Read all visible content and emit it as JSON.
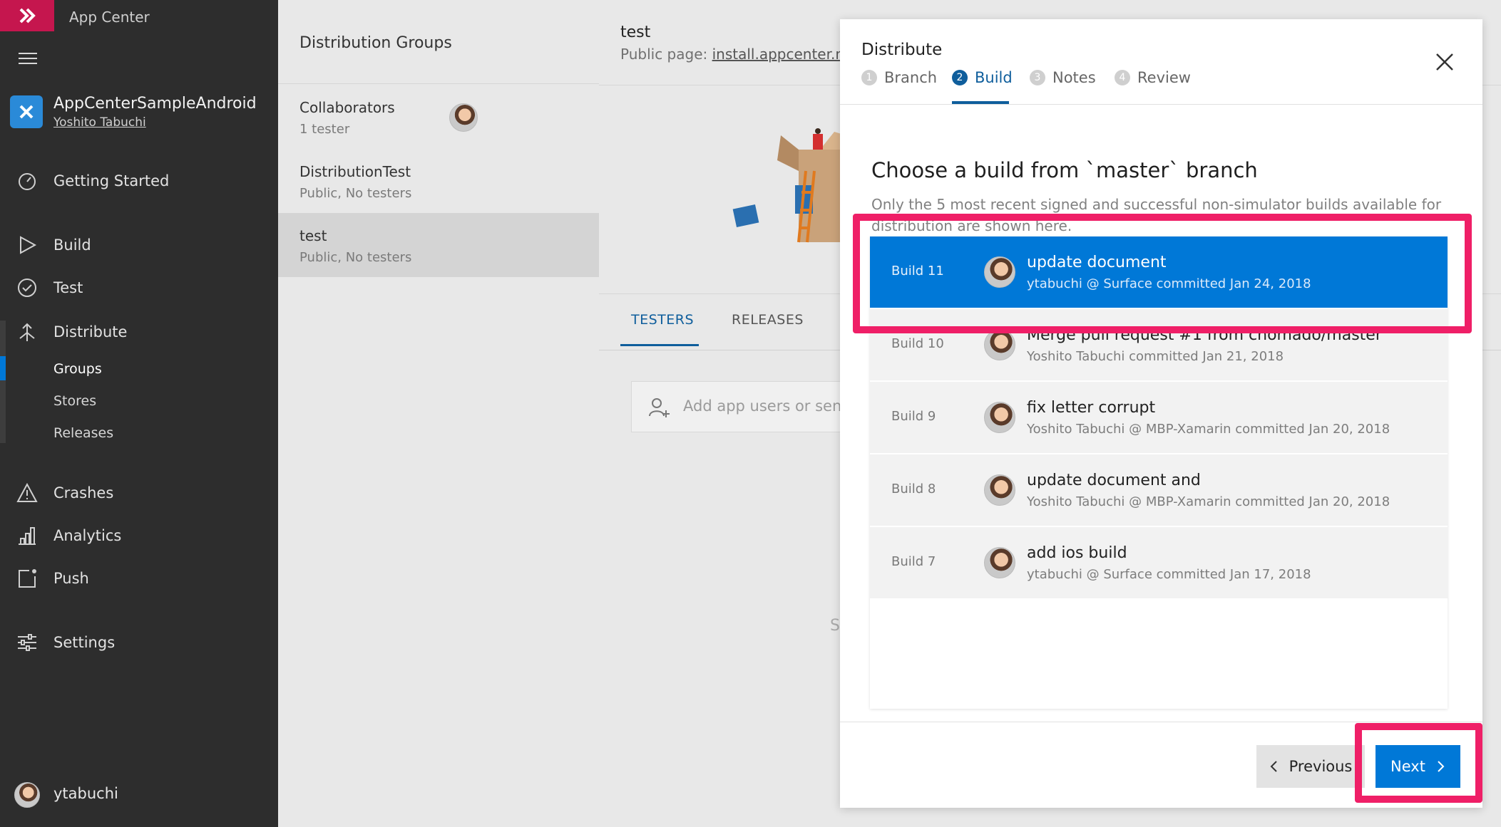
{
  "app": {
    "title": "App Center"
  },
  "nav": {
    "app_name": "AppCenterSampleAndroid",
    "app_owner": "Yoshito Tabuchi",
    "items": [
      {
        "label": "Getting Started",
        "icon": "gauge-icon"
      },
      {
        "label": "Build",
        "icon": "play-icon"
      },
      {
        "label": "Test",
        "icon": "check-circle-icon"
      },
      {
        "label": "Distribute",
        "icon": "distribute-icon"
      },
      {
        "label": "Crashes",
        "icon": "warning-icon"
      },
      {
        "label": "Analytics",
        "icon": "bar-chart-icon"
      },
      {
        "label": "Push",
        "icon": "push-icon"
      },
      {
        "label": "Settings",
        "icon": "sliders-icon"
      }
    ],
    "distribute_sub": [
      "Groups",
      "Stores",
      "Releases"
    ],
    "user": "ytabuchi"
  },
  "groups": {
    "title": "Distribution Groups",
    "items": [
      {
        "name": "Collaborators",
        "meta": "1 tester"
      },
      {
        "name": "DistributionTest",
        "meta": "Public, No testers"
      },
      {
        "name": "test",
        "meta": "Public, No testers"
      }
    ]
  },
  "main": {
    "group_title": "test",
    "public_page_label": "Public page:",
    "public_page_link": "install.appcenter.ms/",
    "tabs": [
      "TESTERS",
      "RELEASES"
    ],
    "add_placeholder": "Add app users or send",
    "stray_char": "S"
  },
  "modal": {
    "title": "Distribute",
    "steps": [
      {
        "num": "1",
        "label": "Branch"
      },
      {
        "num": "2",
        "label": "Build"
      },
      {
        "num": "3",
        "label": "Notes"
      },
      {
        "num": "4",
        "label": "Review"
      }
    ],
    "heading": "Choose a build from `master` branch",
    "description": "Only the 5 most recent signed and successful non-simulator builds available for distribution are shown here.",
    "builds": [
      {
        "number": "Build 11",
        "message": "update document",
        "commit": "ytabuchi @ Surface committed Jan 24, 2018"
      },
      {
        "number": "Build 10",
        "message": "Merge pull request #1 from chomado/master",
        "commit": "Yoshito Tabuchi committed Jan 21, 2018"
      },
      {
        "number": "Build 9",
        "message": "fix letter corrupt",
        "commit": "Yoshito Tabuchi @ MBP-Xamarin committed Jan 20, 2018"
      },
      {
        "number": "Build 8",
        "message": "update document and",
        "commit": "Yoshito Tabuchi @ MBP-Xamarin committed Jan 20, 2018"
      },
      {
        "number": "Build 7",
        "message": "add ios build",
        "commit": "ytabuchi @ Surface committed Jan 17, 2018"
      }
    ],
    "previous_label": "Previous",
    "next_label": "Next"
  },
  "colors": {
    "accent": "#0078d7",
    "brand": "#c5164e",
    "highlight": "#ef1f67",
    "nav_bg": "#2d2d2d"
  }
}
